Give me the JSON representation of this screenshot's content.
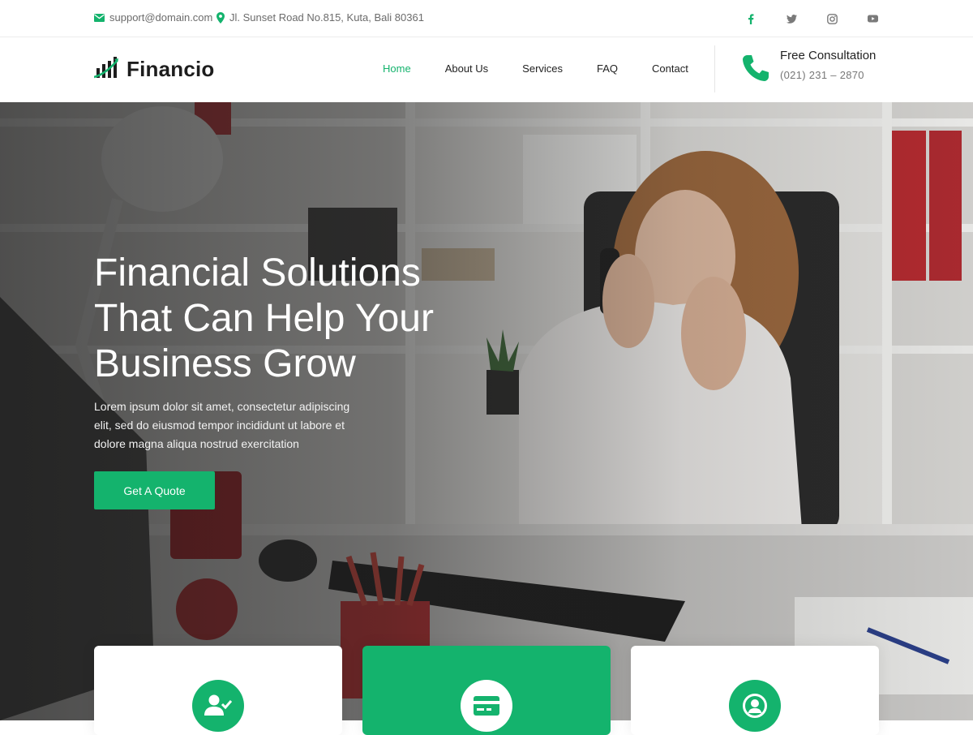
{
  "topbar": {
    "email": "support@domain.com",
    "address": "Jl. Sunset Road No.815, Kuta, Bali 80361",
    "social_icons": [
      "facebook-icon",
      "twitter-icon",
      "instagram-icon",
      "youtube-icon"
    ]
  },
  "header": {
    "logo_text": "Financio",
    "nav": [
      {
        "label": "Home",
        "active": true
      },
      {
        "label": "About Us",
        "active": false
      },
      {
        "label": "Services",
        "active": false
      },
      {
        "label": "FAQ",
        "active": false
      },
      {
        "label": "Contact",
        "active": false
      }
    ],
    "consultation": {
      "title": "Free Consultation",
      "phone": "(021) 231 – 2870",
      "icon": "phone-icon"
    }
  },
  "hero": {
    "title_lines": [
      "Financial Solutions",
      "That Can Help Your",
      "Business Grow"
    ],
    "text": "Lorem ipsum dolor sit amet, consectetur adipiscing elit, sed do eiusmod tempor incididunt ut labore et dolore magna aliqua nostrud exercitation",
    "cta_label": "Get A Quote",
    "background": "office photo of woman on phone at desk"
  },
  "cards": [
    {
      "icon": "user-check-icon",
      "highlighted": false
    },
    {
      "icon": "credit-card-icon",
      "highlighted": true
    },
    {
      "icon": "user-circle-icon",
      "highlighted": false
    }
  ],
  "colors": {
    "accent": "#14b36d",
    "text_dark": "#222222",
    "text_muted": "#6b6b6b"
  }
}
